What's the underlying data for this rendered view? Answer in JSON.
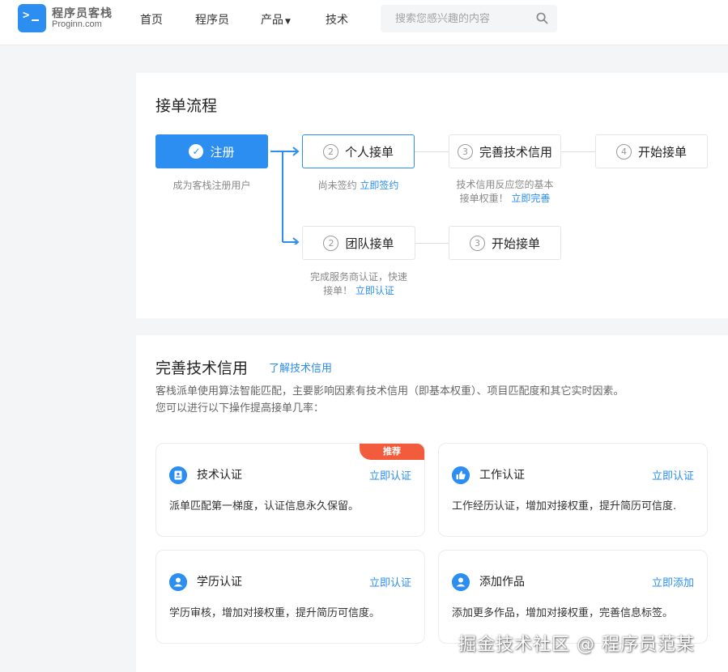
{
  "header": {
    "logo_cn": "程序员客栈",
    "logo_en": "Proginn.com",
    "nav": [
      "首页",
      "程序员",
      "产品",
      "技术"
    ],
    "search_placeholder": "搜索您感兴趣的内容",
    "icons": {
      "logo": "terminal-logo-icon",
      "dropdown": "chevron-down-icon",
      "search": "search-icon"
    }
  },
  "process": {
    "title": "接单流程",
    "steps": {
      "register": {
        "label": "注册",
        "note": "成为客栈注册用户"
      },
      "personal": {
        "num": "2",
        "label": "个人接单",
        "note_text": "尚未签约",
        "note_link": "立即签约"
      },
      "credit": {
        "num": "3",
        "label": "完善技术信用",
        "note_line1": "技术信用反应您的基本",
        "note_line2": "接单权重！",
        "note_link": "立即完善"
      },
      "start_personal": {
        "num": "4",
        "label": "开始接单"
      },
      "team": {
        "num": "2",
        "label": "团队接单",
        "note_line1": "完成服务商认证，快速",
        "note_line2": "接单！",
        "note_link": "立即认证"
      },
      "start_team": {
        "num": "3",
        "label": "开始接单"
      }
    }
  },
  "credit": {
    "title": "完善技术信用",
    "learn_link": "了解技术信用",
    "desc_line1": "客栈派单使用算法智能匹配，主要影响因素有技术信用（即基本权重）、项目匹配度和其它实时因素。",
    "desc_line2": "您可以进行以下操作提高接单几率：",
    "items": [
      {
        "name": "技术认证",
        "action": "立即认证",
        "desc": "派单匹配第一梯度，认证信息永久保留。",
        "badge": "推荐",
        "icon": "certificate-icon"
      },
      {
        "name": "工作认证",
        "action": "立即认证",
        "desc": "工作经历认证，增加对接权重，提升简历可信度.",
        "icon": "thumbs-up-icon"
      },
      {
        "name": "学历认证",
        "action": "立即认证",
        "desc": "学历审核，增加对接权重，提升简历可信度。",
        "icon": "user-icon"
      },
      {
        "name": "添加作品",
        "action": "立即添加",
        "desc": "添加更多作品，增加对接权重，完善信息标签。",
        "icon": "user-icon"
      }
    ]
  },
  "watermark": "掘金技术社区 @ 程序员范某",
  "colors": {
    "accent": "#2b8ef0",
    "badge": "#f25c3c",
    "page_bg": "#f4f5f7"
  }
}
